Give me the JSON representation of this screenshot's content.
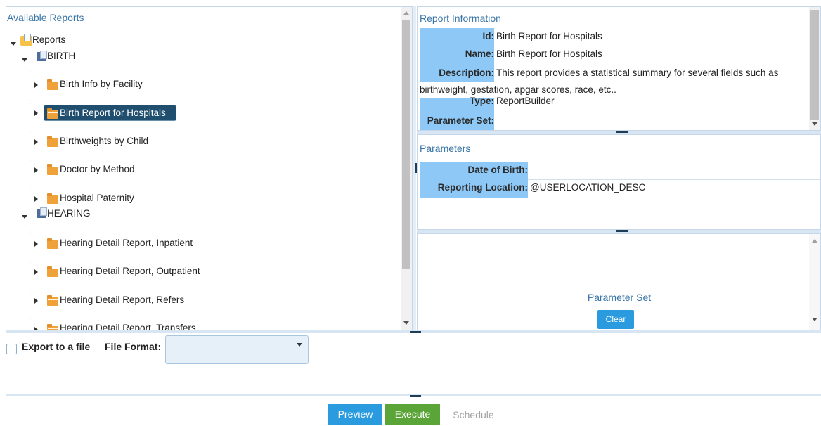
{
  "available_reports": {
    "title": "Available Reports",
    "root": "Reports",
    "groups": [
      {
        "name": "BIRTH",
        "items": [
          "Birth Info by Facility",
          "Birth Report for Hospitals",
          "Birthweights by Child",
          "Doctor by Method",
          "Hospital Paternity"
        ]
      },
      {
        "name": "HEARING",
        "items": [
          "Hearing Detail Report, Inpatient",
          "Hearing Detail Report, Outpatient",
          "Hearing Detail Report, Refers",
          "Hearing Detail Report, Transfers"
        ]
      }
    ],
    "separator": ";"
  },
  "report_info": {
    "title": "Report Information",
    "id_label": "Id:",
    "id_value": "Birth Report for Hospitals",
    "name_label": "Name:",
    "name_value": "Birth Report for Hospitals",
    "description_label": "Description:",
    "description_value_line1": "This report provides a statistical summary for several fields such as",
    "description_value_line2": "birthweight, gestation, apgar scores, race, etc..",
    "type_label": "Type:",
    "type_value": "ReportBuilder",
    "parameter_set_label": "Parameter Set:",
    "parameter_set_value": ""
  },
  "parameters": {
    "title": "Parameters",
    "date_of_birth_label": "Date of Birth:",
    "date_of_birth_value": "",
    "reporting_location_label": "Reporting Location:",
    "reporting_location_value": "@USERLOCATION_DESC"
  },
  "parameter_set": {
    "title": "Parameter Set",
    "clear_label": "Clear"
  },
  "export": {
    "checkbox_label": "Export to a file",
    "checked": false,
    "file_format_label": "File Format:",
    "file_format_value": ""
  },
  "actions": {
    "preview_label": "Preview",
    "execute_label": "Execute",
    "schedule_label": "Schedule"
  },
  "colors": {
    "accent_blue": "#3a76a8",
    "highlight_cell": "#8dc8f6",
    "selected_node": "#1f4e6e",
    "preview_button": "#2b9be0",
    "execute_button": "#5ba538",
    "clear_button": "#2b9be0"
  }
}
